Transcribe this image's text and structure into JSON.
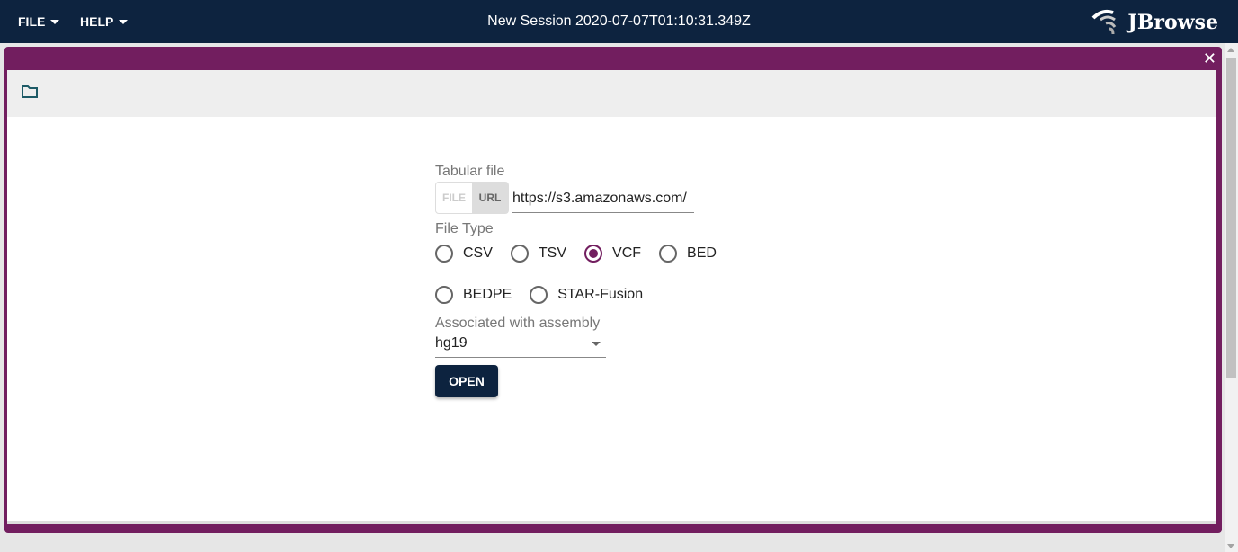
{
  "header": {
    "menus": [
      {
        "label": "FILE"
      },
      {
        "label": "HELP"
      }
    ],
    "title": "New Session 2020-07-07T01:10:31.349Z",
    "logo": "JBrowse"
  },
  "dialog": {
    "close_icon": "close-icon",
    "toolbar_icon": "folder-icon",
    "form": {
      "tabular_label": "Tabular file",
      "toggle": {
        "file": "FILE",
        "url": "URL",
        "selected": "URL"
      },
      "url_value": "https://s3.amazonaws.com/",
      "file_type_label": "File Type",
      "file_types": [
        {
          "label": "CSV",
          "checked": false
        },
        {
          "label": "TSV",
          "checked": false
        },
        {
          "label": "VCF",
          "checked": true
        },
        {
          "label": "BED",
          "checked": false
        },
        {
          "label": "BEDPE",
          "checked": false
        },
        {
          "label": "STAR-Fusion",
          "checked": false
        }
      ],
      "assembly_label": "Associated with assembly",
      "assembly_value": "hg19",
      "open_label": "OPEN"
    }
  },
  "colors": {
    "header": "#0d233f",
    "accent": "#721e5f"
  }
}
